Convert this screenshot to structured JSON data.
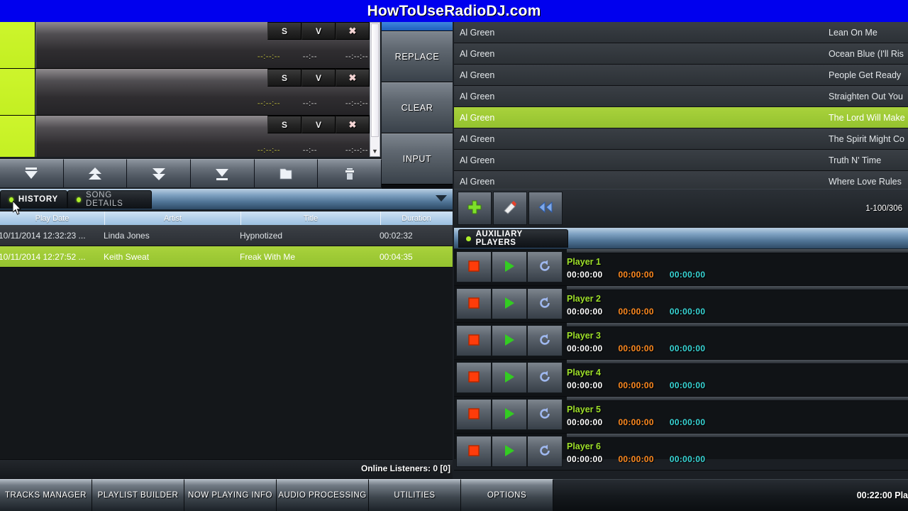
{
  "banner": {
    "text": "HowToUseRadioDJ.com",
    "bg": "#0000ee"
  },
  "queue": {
    "rows": [
      {
        "badge": "",
        "s": "S",
        "v": "V",
        "x": "✖",
        "t1": "--:--:--",
        "t2": "--:--",
        "t3": "--:--:--"
      },
      {
        "badge": "",
        "s": "S",
        "v": "V",
        "x": "✖",
        "t1": "--:--:--",
        "t2": "--:--",
        "t3": "--:--:--"
      },
      {
        "badge": "",
        "s": "S",
        "v": "V",
        "x": "✖",
        "t1": "--:--:--",
        "t2": "--:--",
        "t3": "--:--:--"
      }
    ],
    "toolbar": [
      {
        "name": "move-to-top-icon"
      },
      {
        "name": "move-up-icon"
      },
      {
        "name": "move-down-icon"
      },
      {
        "name": "move-to-bottom-icon"
      },
      {
        "name": "folder-icon"
      },
      {
        "name": "trash-icon"
      }
    ]
  },
  "side_buttons": {
    "replace": "REPLACE",
    "clear": "CLEAR",
    "input": "INPUT"
  },
  "history": {
    "tabs": [
      {
        "label": "HISTORY",
        "active": true
      },
      {
        "label": "SONG DETAILS",
        "active": false
      }
    ],
    "columns": [
      "Play Date",
      "Artist",
      "Title",
      "Duration"
    ],
    "rows": [
      {
        "date": "10/11/2014 12:32:23 ...",
        "artist": "Linda Jones",
        "title": "Hypnotized",
        "duration": "00:02:32",
        "selected": false
      },
      {
        "date": "10/11/2014 12:27:52 ...",
        "artist": "Keith Sweat",
        "title": "Freak With Me",
        "duration": "00:04:35",
        "selected": true
      }
    ],
    "listeners": "Online Listeners: 0 [0]"
  },
  "tracks": {
    "rows": [
      {
        "artist": "Al Green",
        "title": "Lean On Me",
        "selected": false
      },
      {
        "artist": "Al Green",
        "title": "Ocean Blue (I'll Ris",
        "selected": false
      },
      {
        "artist": "Al Green",
        "title": "People Get Ready",
        "selected": false
      },
      {
        "artist": "Al Green",
        "title": "Straighten Out You",
        "selected": false
      },
      {
        "artist": "Al Green",
        "title": "The Lord Will Make",
        "selected": true
      },
      {
        "artist": "Al Green",
        "title": "The Spirit Might Co",
        "selected": false
      },
      {
        "artist": "Al Green",
        "title": "Truth N' Time",
        "selected": false
      },
      {
        "artist": "Al Green",
        "title": "Where Love Rules",
        "selected": false
      }
    ],
    "actions": [
      {
        "name": "add-icon"
      },
      {
        "name": "palette-icon"
      },
      {
        "name": "rewind-icon"
      }
    ],
    "pager": "1-100/306"
  },
  "aux_players": {
    "tab_label": "AUXILIARY PLAYERS",
    "players": [
      {
        "name": "Player 1",
        "elapsed": "00:00:00",
        "remaining": "00:00:00",
        "total": "00:00:00"
      },
      {
        "name": "Player 2",
        "elapsed": "00:00:00",
        "remaining": "00:00:00",
        "total": "00:00:00"
      },
      {
        "name": "Player 3",
        "elapsed": "00:00:00",
        "remaining": "00:00:00",
        "total": "00:00:00"
      },
      {
        "name": "Player 4",
        "elapsed": "00:00:00",
        "remaining": "00:00:00",
        "total": "00:00:00"
      },
      {
        "name": "Player 5",
        "elapsed": "00:00:00",
        "remaining": "00:00:00",
        "total": "00:00:00"
      },
      {
        "name": "Player 6",
        "elapsed": "00:00:00",
        "remaining": "00:00:00",
        "total": "00:00:00"
      }
    ]
  },
  "bottom_bar": {
    "buttons": [
      "TRACKS MANAGER",
      "PLAYLIST BUILDER",
      "NOW PLAYING INFO",
      "AUDIO PROCESSING",
      "UTILITIES",
      "OPTIONS"
    ],
    "status_time": "00:22:00 Pla"
  },
  "colors": {
    "accent_green": "#aef02a",
    "selection_green": "#a9d23c",
    "banner_blue": "#0000ee",
    "timer_orange": "#ff8a1f",
    "timer_cyan": "#38d6d6"
  }
}
